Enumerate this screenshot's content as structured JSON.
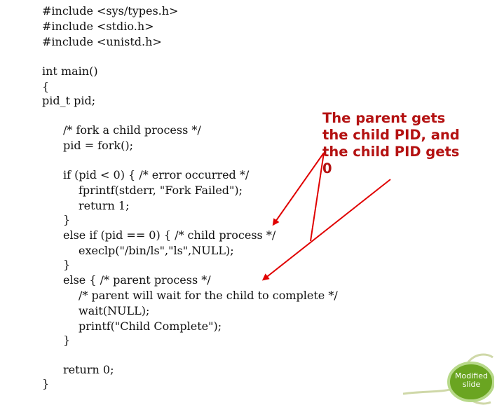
{
  "code": {
    "lines": [
      "#include <sys/types.h>",
      "#include <stdio.h>",
      "#include <unistd.h>",
      "int main()",
      "{",
      "pid_t pid;",
      "/* fork a child process */",
      "pid = fork();",
      "if (pid < 0) { /* error occurred */",
      "fprintf(stderr, \"Fork Failed\");",
      "return 1;",
      "}",
      "else if (pid == 0) { /* child process */",
      "execlp(\"/bin/ls\",\"ls\",NULL);",
      "}",
      "else { /* parent process */",
      "/* parent will wait for the child to complete */",
      "wait(NULL);",
      "printf(\"Child Complete\");",
      "}",
      "return 0;",
      "}"
    ]
  },
  "annotation": {
    "lines": [
      "The parent gets",
      "the child PID, and",
      "the child PID gets",
      "0"
    ]
  },
  "badge": {
    "line1": "Modified",
    "line2": "slide"
  },
  "colors": {
    "annotation": "#b41212",
    "arrow": "#e00000",
    "badge_fill": "#6aa521",
    "badge_stroke": "#b7d989"
  }
}
